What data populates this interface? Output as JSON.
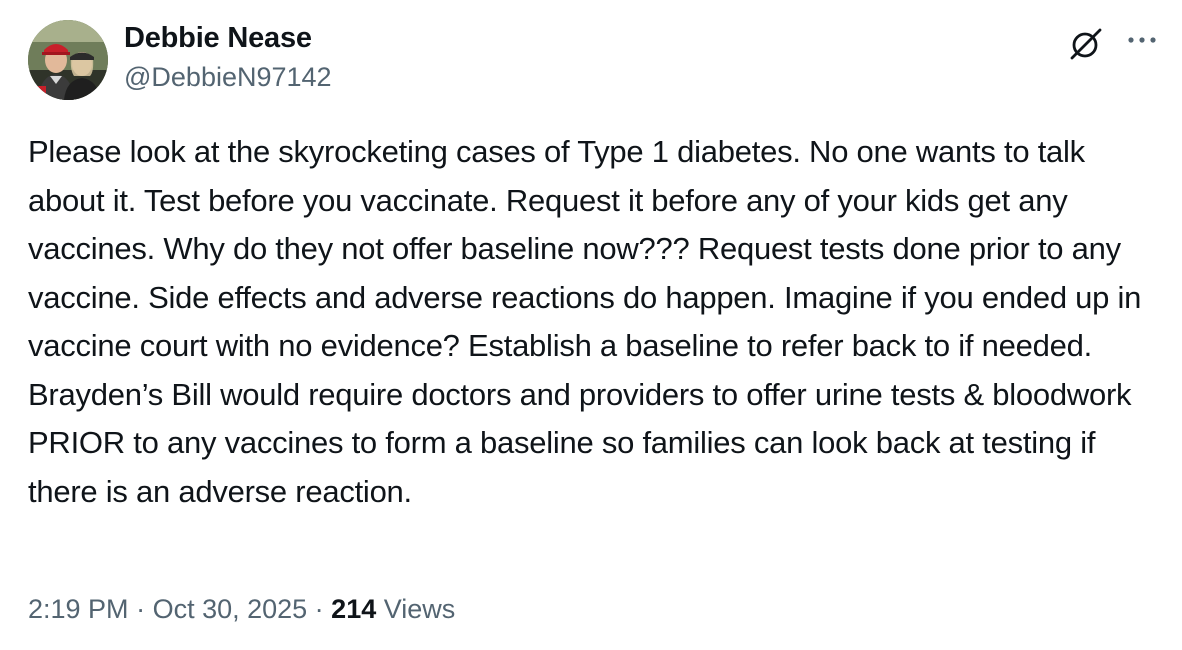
{
  "author": {
    "name": "Debbie Nease",
    "handle": "@DebbieN97142"
  },
  "icons": {
    "grok": "grok-icon",
    "more": "more-icon",
    "avatar": "profile-photo"
  },
  "tweet": {
    "text": "Please look at the skyrocketing cases of Type 1 diabetes. No one wants to talk about it. Test before you vaccinate. Request it before any of your kids get any vaccines. Why do they not offer baseline now??? Request tests done prior to any vaccine. Side effects and adverse reactions do happen. Imagine if you ended up in vaccine court with no evidence? Establish a baseline to refer back to if needed. Brayden’s Bill would require doctors and providers to offer urine tests & bloodwork PRIOR to any vaccines to form a baseline so families can look back at testing if there is an adverse reaction."
  },
  "meta": {
    "time": "2:19 PM",
    "separator": " · ",
    "date": "Oct 30, 2025",
    "views_count": "214",
    "views_label": " Views"
  },
  "colors": {
    "text": "#0f1419",
    "secondary": "#536471",
    "background": "#ffffff"
  }
}
